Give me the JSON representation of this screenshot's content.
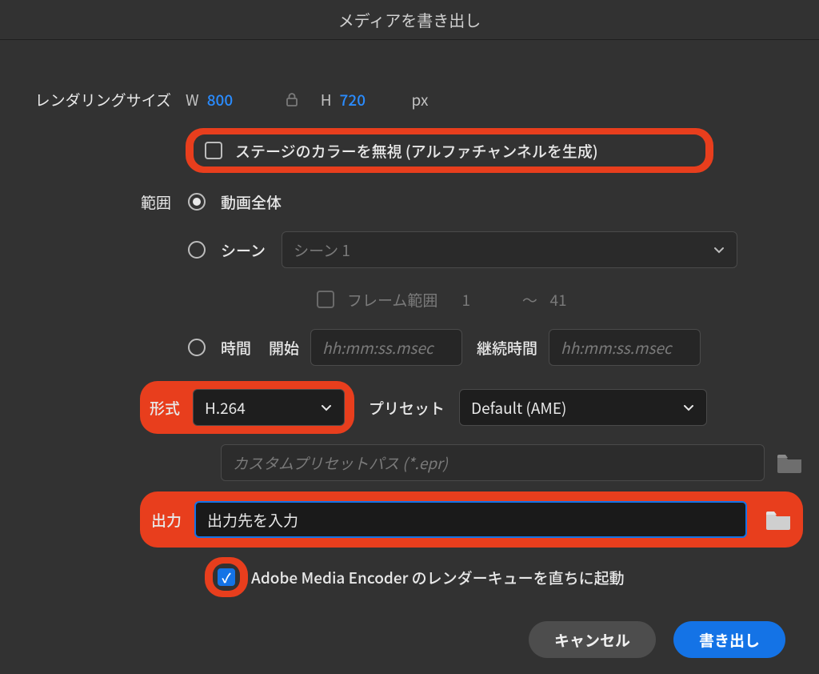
{
  "title": "メディアを書き出し",
  "renderSize": {
    "label": "レンダリングサイズ",
    "w_label": "W",
    "w_value": "800",
    "h_label": "H",
    "h_value": "720",
    "unit": "px"
  },
  "ignoreStage": {
    "label": "ステージのカラーを無視 (アルファチャンネルを生成)"
  },
  "range": {
    "label": "範囲",
    "entire": "動画全体",
    "scene": {
      "label": "シーン",
      "value": "シーン 1"
    },
    "frameRange": {
      "label": "フレーム範囲",
      "from": "1",
      "sep": "〜",
      "to": "41"
    },
    "time": {
      "label": "時間",
      "start_label": "開始",
      "placeholder1": "hh:mm:ss.msec",
      "duration_label": "継続時間",
      "placeholder2": "hh:mm:ss.msec"
    }
  },
  "format": {
    "label": "形式",
    "value": "H.264"
  },
  "preset": {
    "label": "プリセット",
    "value": "Default (AME)"
  },
  "customPreset": {
    "placeholder": "カスタムプリセットパス (*.epr)"
  },
  "output": {
    "label": "出力",
    "placeholder": "出力先を入力"
  },
  "ame": {
    "label": "Adobe Media Encoder のレンダーキューを直ちに起動"
  },
  "buttons": {
    "cancel": "キャンセル",
    "export": "書き出し"
  }
}
